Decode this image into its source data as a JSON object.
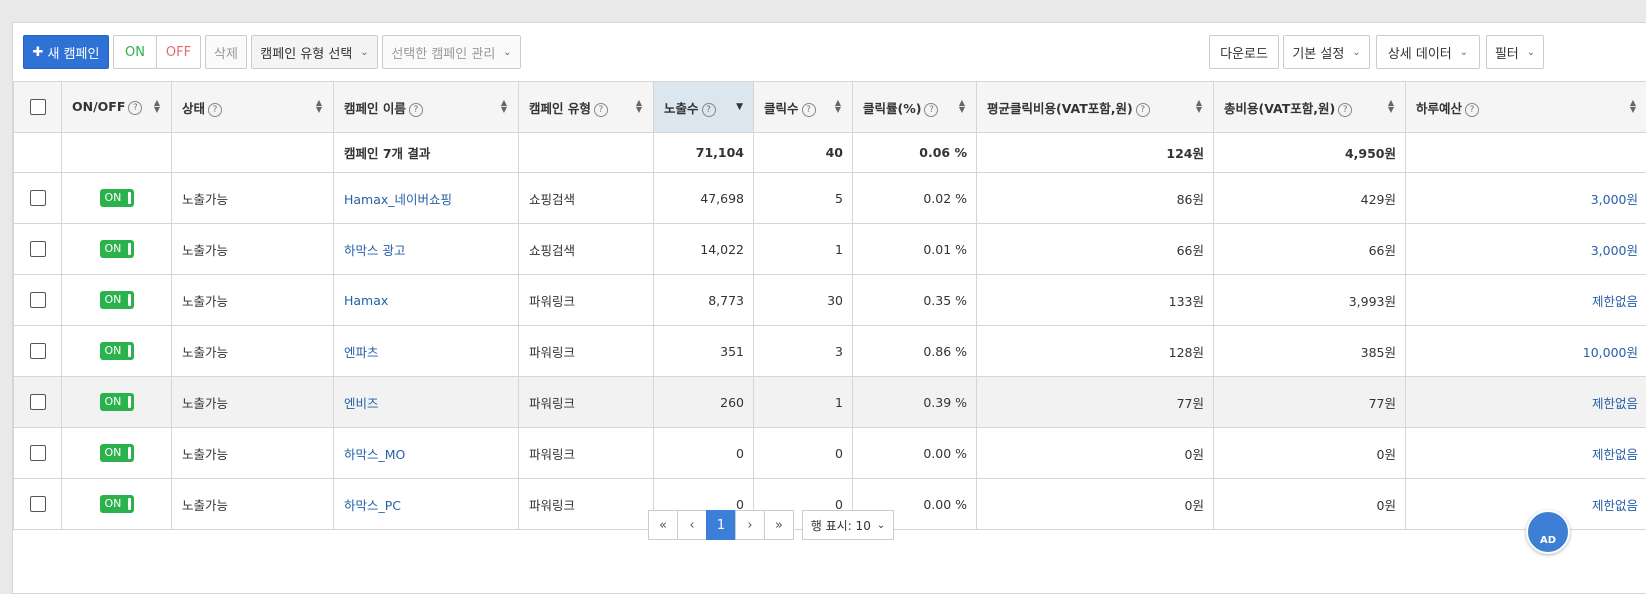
{
  "toolbar": {
    "new_campaign": "새 캠페인",
    "on": "ON",
    "off": "OFF",
    "delete": "삭제",
    "campaign_type_select": "캠페인 유형 선택",
    "manage_selected": "선택한 캠페인 관리",
    "download": "다운로드",
    "basic_settings": "기본 설정",
    "detail_data": "상세 데이터",
    "filter": "필터"
  },
  "columns": [
    "ON/OFF",
    "상태",
    "캠페인 이름",
    "캠페인 유형",
    "노출수",
    "클릭수",
    "클릭률(%)",
    "평균클릭비용(VAT포함,원)",
    "총비용(VAT포함,원)",
    "하루예산"
  ],
  "summary": {
    "label": "캠페인 7개 결과",
    "impressions": "71,104",
    "clicks": "40",
    "ctr": "0.06 %",
    "avg_cpc": "124원",
    "total_cost": "4,950원"
  },
  "rows": [
    {
      "toggle": "ON",
      "status": "노출가능",
      "name": "Hamax_네이버쇼핑",
      "type": "쇼핑검색",
      "impressions": "47,698",
      "clicks": "5",
      "ctr": "0.02 %",
      "avg_cpc": "86원",
      "total_cost": "429원",
      "budget": "3,000원"
    },
    {
      "toggle": "ON",
      "status": "노출가능",
      "name": "하막스 광고",
      "type": "쇼핑검색",
      "impressions": "14,022",
      "clicks": "1",
      "ctr": "0.01 %",
      "avg_cpc": "66원",
      "total_cost": "66원",
      "budget": "3,000원"
    },
    {
      "toggle": "ON",
      "status": "노출가능",
      "name": "Hamax",
      "type": "파워링크",
      "impressions": "8,773",
      "clicks": "30",
      "ctr": "0.35 %",
      "avg_cpc": "133원",
      "total_cost": "3,993원",
      "budget": "제한없음"
    },
    {
      "toggle": "ON",
      "status": "노출가능",
      "name": "엔파츠",
      "type": "파워링크",
      "impressions": "351",
      "clicks": "3",
      "ctr": "0.86 %",
      "avg_cpc": "128원",
      "total_cost": "385원",
      "budget": "10,000원"
    },
    {
      "toggle": "ON",
      "status": "노출가능",
      "name": "엔비즈",
      "type": "파워링크",
      "impressions": "260",
      "clicks": "1",
      "ctr": "0.39 %",
      "avg_cpc": "77원",
      "total_cost": "77원",
      "budget": "제한없음"
    },
    {
      "toggle": "ON",
      "status": "노출가능",
      "name": "하막스_MO",
      "type": "파워링크",
      "impressions": "0",
      "clicks": "0",
      "ctr": "0.00 %",
      "avg_cpc": "0원",
      "total_cost": "0원",
      "budget": "제한없음"
    },
    {
      "toggle": "ON",
      "status": "노출가능",
      "name": "하막스_PC",
      "type": "파워링크",
      "impressions": "0",
      "clicks": "0",
      "ctr": "0.00 %",
      "avg_cpc": "0원",
      "total_cost": "0원",
      "budget": "제한없음"
    }
  ],
  "pagination": {
    "first": "«",
    "prev": "‹",
    "current": "1",
    "next": "›",
    "last": "»",
    "rows_per_page": "행 표시: 10"
  },
  "ad_badge": "AD"
}
